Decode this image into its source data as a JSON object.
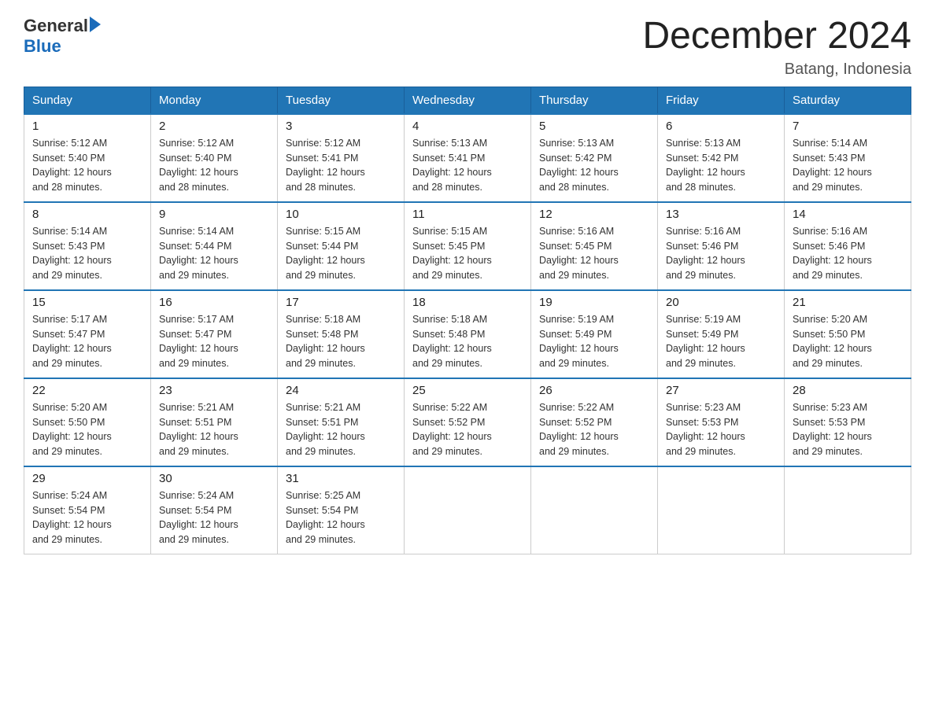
{
  "header": {
    "logo_general": "General",
    "logo_blue": "Blue",
    "title": "December 2024",
    "subtitle": "Batang, Indonesia"
  },
  "days_of_week": [
    "Sunday",
    "Monday",
    "Tuesday",
    "Wednesday",
    "Thursday",
    "Friday",
    "Saturday"
  ],
  "weeks": [
    [
      {
        "day": "1",
        "sunrise": "5:12 AM",
        "sunset": "5:40 PM",
        "daylight": "12 hours and 28 minutes."
      },
      {
        "day": "2",
        "sunrise": "5:12 AM",
        "sunset": "5:40 PM",
        "daylight": "12 hours and 28 minutes."
      },
      {
        "day": "3",
        "sunrise": "5:12 AM",
        "sunset": "5:41 PM",
        "daylight": "12 hours and 28 minutes."
      },
      {
        "day": "4",
        "sunrise": "5:13 AM",
        "sunset": "5:41 PM",
        "daylight": "12 hours and 28 minutes."
      },
      {
        "day": "5",
        "sunrise": "5:13 AM",
        "sunset": "5:42 PM",
        "daylight": "12 hours and 28 minutes."
      },
      {
        "day": "6",
        "sunrise": "5:13 AM",
        "sunset": "5:42 PM",
        "daylight": "12 hours and 28 minutes."
      },
      {
        "day": "7",
        "sunrise": "5:14 AM",
        "sunset": "5:43 PM",
        "daylight": "12 hours and 29 minutes."
      }
    ],
    [
      {
        "day": "8",
        "sunrise": "5:14 AM",
        "sunset": "5:43 PM",
        "daylight": "12 hours and 29 minutes."
      },
      {
        "day": "9",
        "sunrise": "5:14 AM",
        "sunset": "5:44 PM",
        "daylight": "12 hours and 29 minutes."
      },
      {
        "day": "10",
        "sunrise": "5:15 AM",
        "sunset": "5:44 PM",
        "daylight": "12 hours and 29 minutes."
      },
      {
        "day": "11",
        "sunrise": "5:15 AM",
        "sunset": "5:45 PM",
        "daylight": "12 hours and 29 minutes."
      },
      {
        "day": "12",
        "sunrise": "5:16 AM",
        "sunset": "5:45 PM",
        "daylight": "12 hours and 29 minutes."
      },
      {
        "day": "13",
        "sunrise": "5:16 AM",
        "sunset": "5:46 PM",
        "daylight": "12 hours and 29 minutes."
      },
      {
        "day": "14",
        "sunrise": "5:16 AM",
        "sunset": "5:46 PM",
        "daylight": "12 hours and 29 minutes."
      }
    ],
    [
      {
        "day": "15",
        "sunrise": "5:17 AM",
        "sunset": "5:47 PM",
        "daylight": "12 hours and 29 minutes."
      },
      {
        "day": "16",
        "sunrise": "5:17 AM",
        "sunset": "5:47 PM",
        "daylight": "12 hours and 29 minutes."
      },
      {
        "day": "17",
        "sunrise": "5:18 AM",
        "sunset": "5:48 PM",
        "daylight": "12 hours and 29 minutes."
      },
      {
        "day": "18",
        "sunrise": "5:18 AM",
        "sunset": "5:48 PM",
        "daylight": "12 hours and 29 minutes."
      },
      {
        "day": "19",
        "sunrise": "5:19 AM",
        "sunset": "5:49 PM",
        "daylight": "12 hours and 29 minutes."
      },
      {
        "day": "20",
        "sunrise": "5:19 AM",
        "sunset": "5:49 PM",
        "daylight": "12 hours and 29 minutes."
      },
      {
        "day": "21",
        "sunrise": "5:20 AM",
        "sunset": "5:50 PM",
        "daylight": "12 hours and 29 minutes."
      }
    ],
    [
      {
        "day": "22",
        "sunrise": "5:20 AM",
        "sunset": "5:50 PM",
        "daylight": "12 hours and 29 minutes."
      },
      {
        "day": "23",
        "sunrise": "5:21 AM",
        "sunset": "5:51 PM",
        "daylight": "12 hours and 29 minutes."
      },
      {
        "day": "24",
        "sunrise": "5:21 AM",
        "sunset": "5:51 PM",
        "daylight": "12 hours and 29 minutes."
      },
      {
        "day": "25",
        "sunrise": "5:22 AM",
        "sunset": "5:52 PM",
        "daylight": "12 hours and 29 minutes."
      },
      {
        "day": "26",
        "sunrise": "5:22 AM",
        "sunset": "5:52 PM",
        "daylight": "12 hours and 29 minutes."
      },
      {
        "day": "27",
        "sunrise": "5:23 AM",
        "sunset": "5:53 PM",
        "daylight": "12 hours and 29 minutes."
      },
      {
        "day": "28",
        "sunrise": "5:23 AM",
        "sunset": "5:53 PM",
        "daylight": "12 hours and 29 minutes."
      }
    ],
    [
      {
        "day": "29",
        "sunrise": "5:24 AM",
        "sunset": "5:54 PM",
        "daylight": "12 hours and 29 minutes."
      },
      {
        "day": "30",
        "sunrise": "5:24 AM",
        "sunset": "5:54 PM",
        "daylight": "12 hours and 29 minutes."
      },
      {
        "day": "31",
        "sunrise": "5:25 AM",
        "sunset": "5:54 PM",
        "daylight": "12 hours and 29 minutes."
      },
      null,
      null,
      null,
      null
    ]
  ],
  "labels": {
    "sunrise": "Sunrise:",
    "sunset": "Sunset:",
    "daylight": "Daylight:"
  }
}
